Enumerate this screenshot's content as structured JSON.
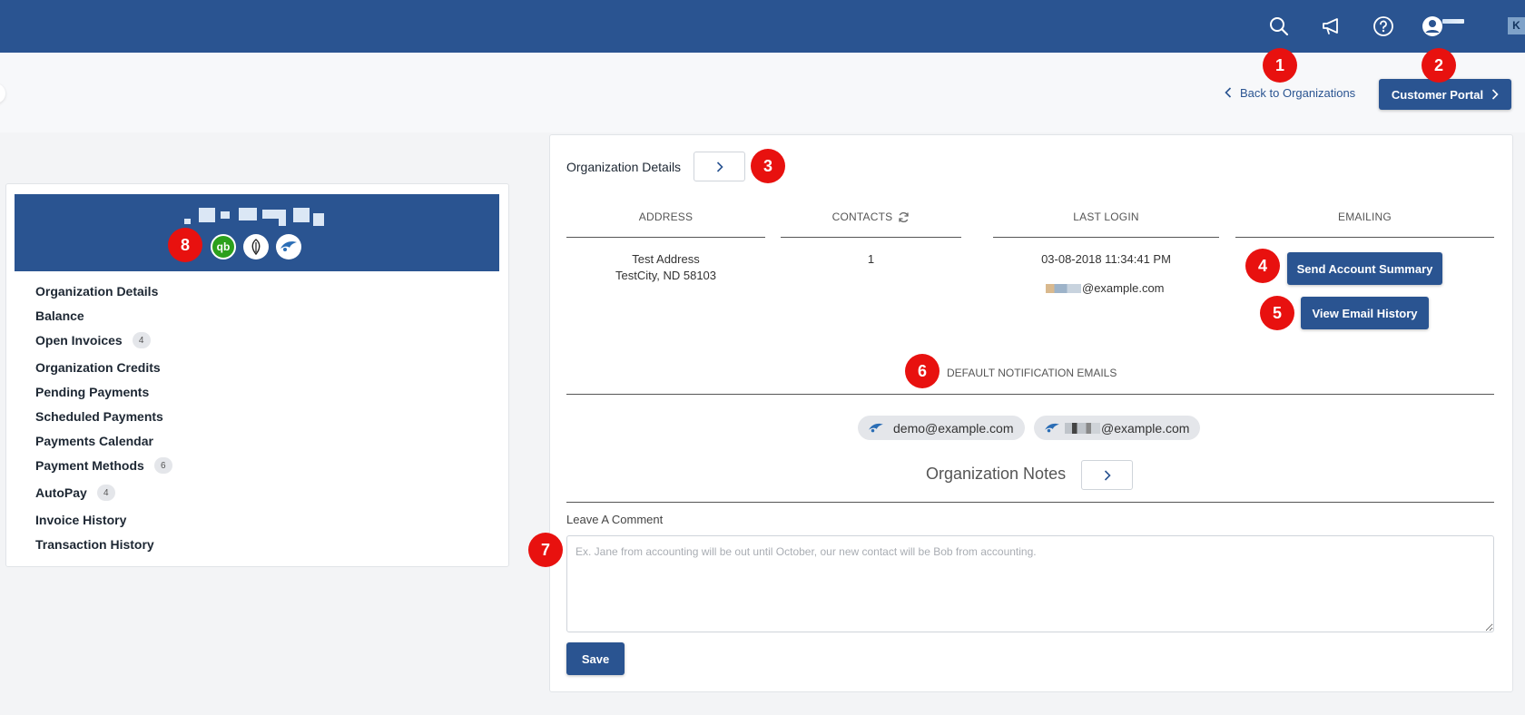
{
  "header": {
    "icons": [
      "search-icon",
      "megaphone-icon",
      "help-icon",
      "user-avatar-icon"
    ],
    "corner_label": "K"
  },
  "nav": {
    "back_label": "Back to Organizations",
    "portal_label": "Customer Portal"
  },
  "sidebar": {
    "banner_icons": [
      "quickbooks-icon",
      "leaf-icon",
      "bird-icon"
    ],
    "items": [
      {
        "label": "Organization Details",
        "count": ""
      },
      {
        "label": "Balance",
        "count": ""
      },
      {
        "label": "Open Invoices",
        "count": "4"
      },
      {
        "label": "Organization Credits",
        "count": ""
      },
      {
        "label": "Pending Payments",
        "count": ""
      },
      {
        "label": "Scheduled Payments",
        "count": ""
      },
      {
        "label": "Payments Calendar",
        "count": ""
      },
      {
        "label": "Payment Methods",
        "count": "6"
      },
      {
        "label": "AutoPay",
        "count": "4"
      },
      {
        "label": "Invoice History",
        "count": ""
      },
      {
        "label": "Transaction History",
        "count": ""
      }
    ]
  },
  "details": {
    "title": "Organization Details",
    "columns": [
      "ADDRESS",
      "CONTACTS",
      "LAST LOGIN",
      "EMAILING"
    ],
    "address_line1": "Test Address",
    "address_line2": "TestCity, ND 58103",
    "contacts_count": "1",
    "last_login": "03-08-2018 11:34:41 PM",
    "last_login_email_suffix": "@example.com",
    "send_summary_label": "Send Account Summary",
    "view_history_label": "View Email History"
  },
  "notifications": {
    "title": "DEFAULT NOTIFICATION EMAILS",
    "emails": [
      "demo@example.com",
      "@example.com"
    ]
  },
  "notes": {
    "title": "Organization Notes",
    "comment_label": "Leave A Comment",
    "comment_placeholder": "Ex. Jane from accounting will be out until October, our new contact will be Bob from accounting.",
    "save_label": "Save"
  },
  "annotations": [
    "1",
    "2",
    "3",
    "4",
    "5",
    "6",
    "7",
    "8"
  ],
  "colors": {
    "brand": "#2a5491",
    "annotation": "#e8110f",
    "quickbooks": "#2ca01c"
  }
}
